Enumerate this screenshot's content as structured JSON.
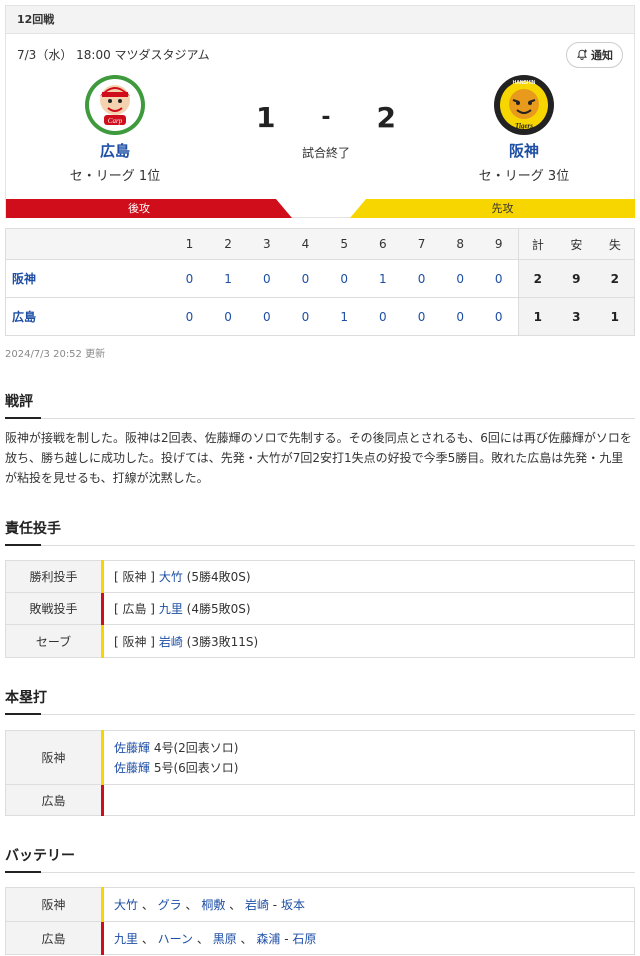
{
  "header": {
    "round": "12回戦"
  },
  "game": {
    "datetime_venue": "7/3（水） 18:00 マツダスタジアム",
    "notify_label": "通知",
    "status": "試合終了",
    "home": {
      "name": "広島",
      "rank": "セ・リーグ 1位",
      "score": "1",
      "bar_label": "後攻",
      "logo_text": "Carp"
    },
    "away": {
      "name": "阪神",
      "rank": "セ・リーグ 3位",
      "score": "2",
      "bar_label": "先攻",
      "logo_top": "HANSHIN",
      "logo_text": "Tigers"
    },
    "dash": "-"
  },
  "linescore": {
    "headers": [
      "1",
      "2",
      "3",
      "4",
      "5",
      "6",
      "7",
      "8",
      "9",
      "計",
      "安",
      "失"
    ],
    "rows": [
      {
        "team": "阪神",
        "innings": [
          "0",
          "1",
          "0",
          "0",
          "0",
          "1",
          "0",
          "0",
          "0"
        ],
        "totals": [
          "2",
          "9",
          "2"
        ]
      },
      {
        "team": "広島",
        "innings": [
          "0",
          "0",
          "0",
          "0",
          "1",
          "0",
          "0",
          "0",
          "0"
        ],
        "totals": [
          "1",
          "3",
          "1"
        ]
      }
    ],
    "updated": "2024/7/3 20:52 更新"
  },
  "review": {
    "title": "戦評",
    "text": "阪神が接戦を制した。阪神は2回表、佐藤輝のソロで先制する。その後同点とされるも、6回には再び佐藤輝がソロを放ち、勝ち越しに成功した。投げては、先発・大竹が7回2安打1失点の好投で今季5勝目。敗れた広島は先発・九里が粘投を見せるも、打線が沈黙した。"
  },
  "pitchers": {
    "title": "責任投手",
    "rows": [
      {
        "label": "勝利投手",
        "team": "[ 阪神 ]",
        "name": "大竹",
        "record": "(5勝4敗0S)",
        "color": "#f7d600"
      },
      {
        "label": "敗戦投手",
        "team": "[ 広島 ]",
        "name": "九里",
        "record": "(4勝5敗0S)",
        "color": "#cf0d1b"
      },
      {
        "label": "セーブ",
        "team": "[ 阪神 ]",
        "name": "岩崎",
        "record": "(3勝3敗11S)",
        "color": "#f7d600"
      }
    ]
  },
  "homeruns": {
    "title": "本塁打",
    "tigers_label": "阪神",
    "carp_label": "広島",
    "tigers": [
      {
        "name": "佐藤輝",
        "detail": "4号(2回表ソロ)"
      },
      {
        "name": "佐藤輝",
        "detail": "5号(6回表ソロ)"
      }
    ]
  },
  "battery": {
    "title": "バッテリー",
    "tigers_label": "阪神",
    "carp_label": "広島",
    "tigers_pitchers": [
      "大竹",
      "グラ",
      "桐敷",
      "岩崎"
    ],
    "tigers_catcher": "坂本",
    "carp_pitchers": [
      "九里",
      "ハーン",
      "黒原",
      "森浦"
    ],
    "carp_catcher": "石原"
  },
  "colors": {
    "carp_red": "#cf0d1b",
    "tigers_yellow": "#f7d600",
    "link_blue": "#1e4fa5"
  }
}
